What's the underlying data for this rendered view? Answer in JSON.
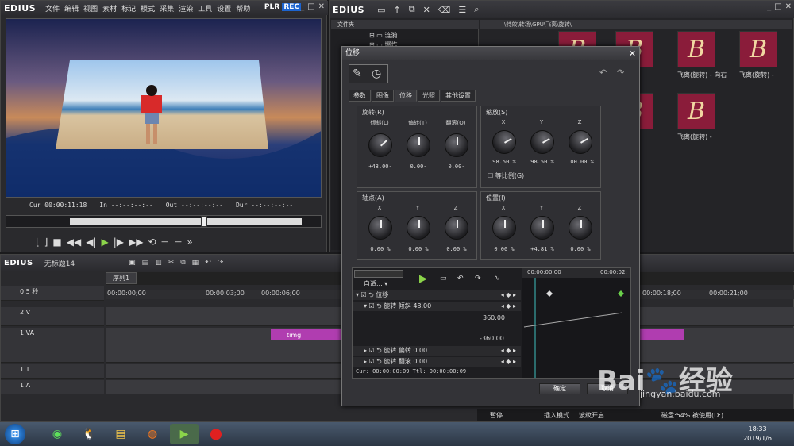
{
  "player": {
    "app_name": "EDIUS",
    "menu": [
      "文件",
      "编辑",
      "视图",
      "素材",
      "标记",
      "模式",
      "采集",
      "渲染",
      "工具",
      "设置",
      "帮助"
    ],
    "plr": "PLR",
    "rec": "REC",
    "cur_label": "Cur",
    "cur": "00:00:11:18",
    "in_label": "In",
    "in": "--:--:--:--",
    "out_label": "Out",
    "out": "--:--:--:--",
    "dur_label": "Dur",
    "dur": "--:--:--:--",
    "scrub_position": 0.58
  },
  "bin": {
    "app_name": "EDIUS",
    "tree_header": "文件夹",
    "tree_items": [
      "涟漪",
      "爆炸"
    ],
    "path": "\\特效\\转场\\GPU\\飞离\\旋转\\",
    "thumb_glyph": "B",
    "thumb_labels": [
      "飞离(旋转) - 向右",
      "飞离(旋转) -",
      "飞离(旋转) -"
    ]
  },
  "timeline": {
    "app_name": "EDIUS",
    "project": "无标题14",
    "sequence": "序列1",
    "zoom": "0.5 秒",
    "ruler": [
      "00:00:00;00",
      "00:00:03;00",
      "00:00:06;00",
      "00:00:18;00",
      "00:00:21;00"
    ],
    "tracks": [
      {
        "name": "2 V"
      },
      {
        "name": "1 VA"
      },
      {
        "name": "1 T"
      },
      {
        "name": "1 A"
      }
    ],
    "clip_name": "timg",
    "status": [
      "暂停",
      "插入模式",
      "波纹开启",
      "磁盘:54% 被使用(D:)"
    ]
  },
  "dialog": {
    "title": "位移",
    "tabs": [
      "参数",
      "图像",
      "位移",
      "光照",
      "其他设置"
    ],
    "active_tab": 2,
    "rotation": {
      "title": "旋转(R)",
      "labels": [
        "倾斜(L)",
        "偏转(T)",
        "翻滚(O)"
      ],
      "values": [
        "+48.00-",
        "0.00-",
        "0.00-"
      ]
    },
    "scale": {
      "title": "缩放(S)",
      "labels": [
        "X",
        "Y",
        "Z"
      ],
      "values": [
        "98.50 %",
        "98.50 %",
        "100.00 %"
      ],
      "proportional": "等比例(G)"
    },
    "pivot": {
      "title": "轴点(A)",
      "labels": [
        "X",
        "Y",
        "Z"
      ],
      "values": [
        "0.00 %",
        "0.00 %",
        "0.00 %"
      ]
    },
    "position": {
      "title": "位置(I)",
      "labels": [
        "X",
        "Y",
        "Z"
      ],
      "values": [
        "0.00 %",
        "+4.81 %",
        "0.00 %"
      ]
    },
    "keyframe": {
      "mode": "自适...",
      "rows": [
        "位移",
        "旋转 倾斜",
        "旋转 偏转",
        "旋转 翻滚"
      ],
      "row_values": [
        "",
        "48.00",
        "0.00",
        "0.00"
      ],
      "max": "360.00",
      "min": "-360.00",
      "cur_label": "Cur",
      "cur": "00:00:00:09",
      "ttl_label": "Ttl",
      "ttl": "00:00:00:09",
      "ruler": [
        "00:00:00:00",
        "00:00:02:"
      ]
    },
    "ok": "确定",
    "cancel": "取消"
  },
  "taskbar": {
    "time": "18:33",
    "date": "2019/1/6"
  },
  "watermark": {
    "brand": "Bai",
    "brand2": "经验",
    "url": "jingyan.baidu.com"
  }
}
